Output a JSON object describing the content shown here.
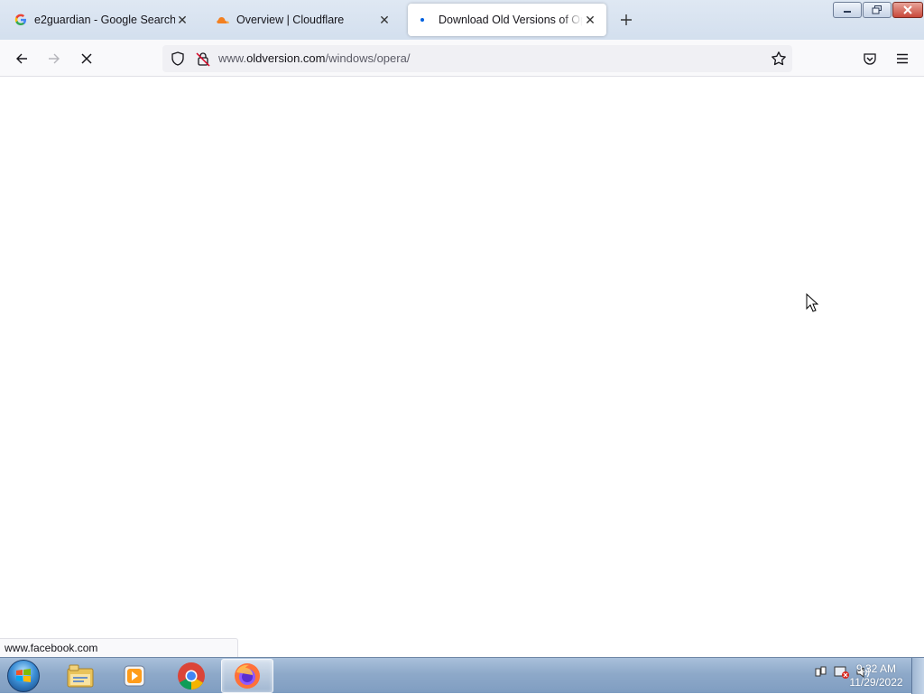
{
  "browser": {
    "tabs": [
      {
        "label": "e2guardian - Google Search",
        "icon": "google-icon",
        "selected": false
      },
      {
        "label": "Overview | Cloudflare",
        "icon": "cloudflare-icon",
        "selected": false
      },
      {
        "label": "Download Old Versions of Opera",
        "icon": "loading-dot-icon",
        "selected": true
      }
    ],
    "url": {
      "prefix": "www.",
      "host": "oldversion.com",
      "path": "/windows/opera/"
    },
    "status_text": "www.facebook.com",
    "colors": {
      "accent": "#0060df",
      "url_muted": "#5b5b66"
    }
  },
  "taskbar": {
    "apps": [
      "windows-explorer-icon",
      "media-player-icon",
      "chrome-icon",
      "firefox-icon"
    ],
    "active_app": "firefox-icon",
    "clock": {
      "time": "9:32 AM",
      "date": "11/29/2022"
    }
  }
}
